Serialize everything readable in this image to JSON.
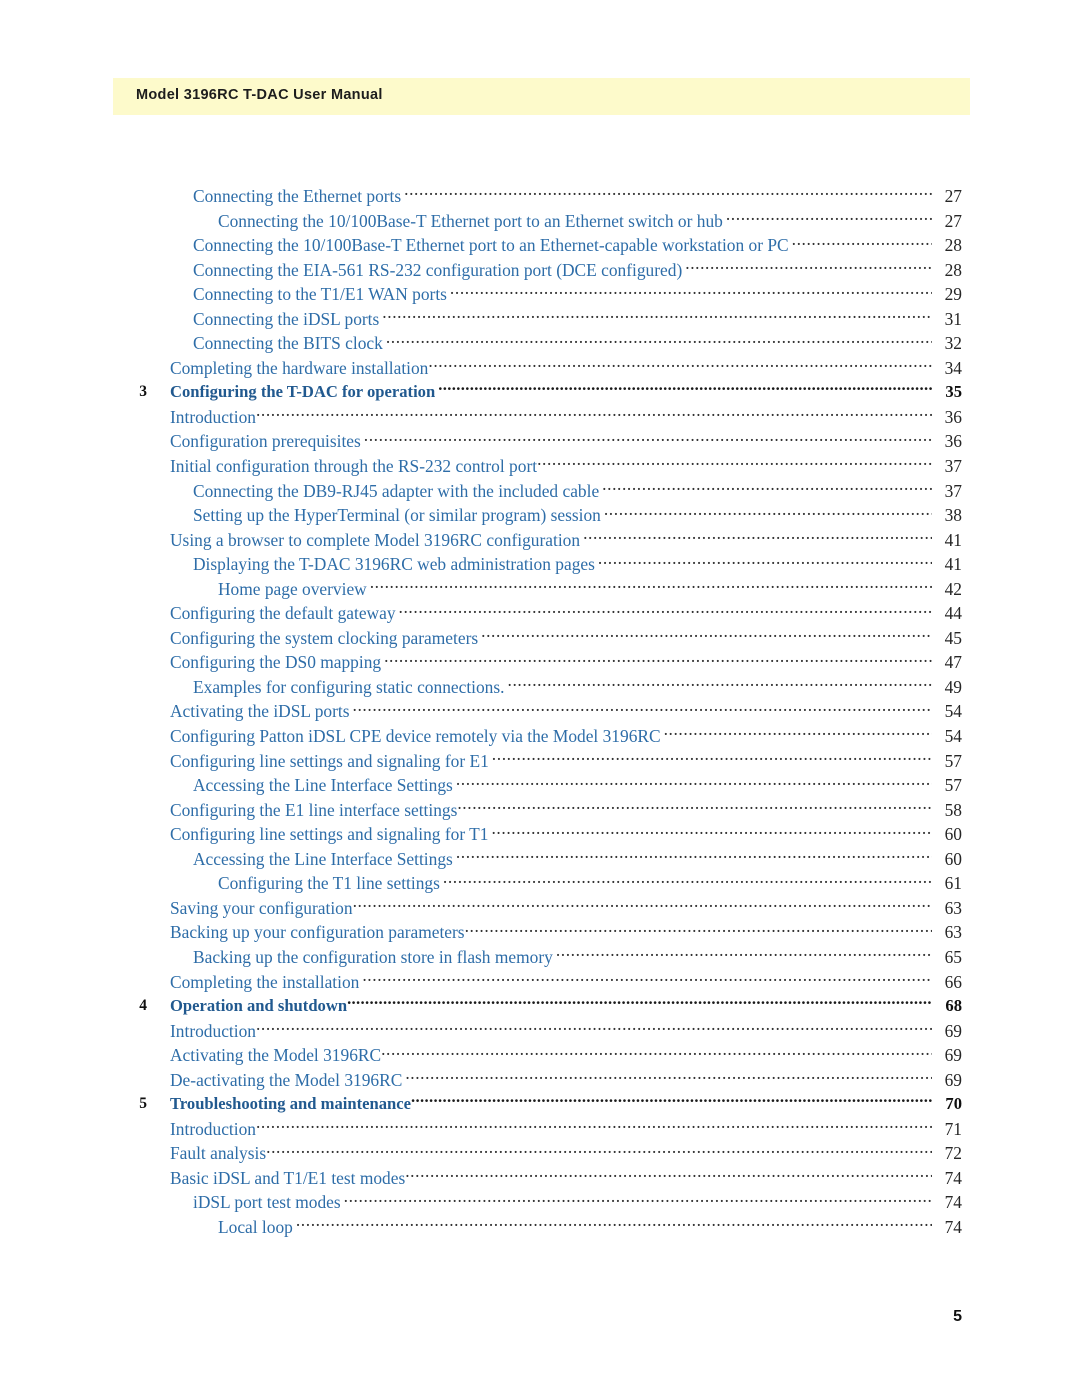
{
  "header": {
    "title": "Model 3196RC T-DAC User Manual"
  },
  "folio": {
    "page_number": "5"
  },
  "toc": {
    "entries": [
      {
        "level": 2,
        "number": "",
        "label": "Connecting the Ethernet ports",
        "page": "27",
        "nogap": false
      },
      {
        "level": 3,
        "number": "",
        "label": "Connecting the 10/100Base-T Ethernet port to an Ethernet switch or hub",
        "page": "27",
        "nogap": false
      },
      {
        "level": 2,
        "number": "",
        "label": "Connecting the 10/100Base-T Ethernet port to an Ethernet-capable workstation or PC",
        "page": "28",
        "nogap": false
      },
      {
        "level": 2,
        "number": "",
        "label": "Connecting the EIA-561 RS-232 configuration port (DCE configured)",
        "page": "28",
        "nogap": false
      },
      {
        "level": 2,
        "number": "",
        "label": "Connecting to the T1/E1 WAN ports",
        "page": "29",
        "nogap": false
      },
      {
        "level": 2,
        "number": "",
        "label": "Connecting the iDSL ports",
        "page": "31",
        "nogap": false
      },
      {
        "level": 2,
        "number": "",
        "label": "Connecting the BITS clock",
        "page": "32",
        "nogap": false
      },
      {
        "level": 1,
        "number": "",
        "label": "Completing the hardware installation",
        "page": "34",
        "nogap": true
      },
      {
        "level": 0,
        "number": "3",
        "label": "Configuring the T-DAC for operation",
        "page": "35",
        "nogap": false
      },
      {
        "level": 1,
        "number": "",
        "label": "Introduction",
        "page": "36",
        "nogap": true
      },
      {
        "level": 1,
        "number": "",
        "label": "Configuration prerequisites",
        "page": "36",
        "nogap": false
      },
      {
        "level": 1,
        "number": "",
        "label": "Initial configuration through the RS-232 control port",
        "page": "37",
        "nogap": true
      },
      {
        "level": 2,
        "number": "",
        "label": "Connecting the DB9-RJ45 adapter with the included cable",
        "page": "37",
        "nogap": false
      },
      {
        "level": 2,
        "number": "",
        "label": "Setting up the HyperTerminal (or similar program) session",
        "page": "38",
        "nogap": false
      },
      {
        "level": 1,
        "number": "",
        "label": "Using a browser to complete Model 3196RC configuration",
        "page": "41",
        "nogap": false
      },
      {
        "level": 2,
        "number": "",
        "label": "Displaying the T-DAC 3196RC web administration pages",
        "page": "41",
        "nogap": false
      },
      {
        "level": 3,
        "number": "",
        "label": "Home page overview",
        "page": "42",
        "nogap": false
      },
      {
        "level": 1,
        "number": "",
        "label": "Configuring the default gateway",
        "page": "44",
        "nogap": false
      },
      {
        "level": 1,
        "number": "",
        "label": "Configuring the system clocking parameters",
        "page": "45",
        "nogap": false
      },
      {
        "level": 1,
        "number": "",
        "label": "Configuring the DS0 mapping",
        "page": "47",
        "nogap": false
      },
      {
        "level": 2,
        "number": "",
        "label": "Examples for configuring static connections.",
        "page": "49",
        "nogap": false
      },
      {
        "level": 1,
        "number": "",
        "label": "Activating the iDSL ports",
        "page": "54",
        "nogap": false
      },
      {
        "level": 1,
        "number": "",
        "label": "Configuring Patton iDSL CPE device remotely via the Model 3196RC",
        "page": "54",
        "nogap": false
      },
      {
        "level": 1,
        "number": "",
        "label": "Configuring line settings and signaling for E1",
        "page": "57",
        "nogap": false
      },
      {
        "level": 2,
        "number": "",
        "label": "Accessing the Line Interface Settings",
        "page": "57",
        "nogap": false
      },
      {
        "level": 1,
        "number": "",
        "label": "Configuring the E1 line interface settings",
        "page": "58",
        "nogap": true
      },
      {
        "level": 1,
        "number": "",
        "label": "Configuring line settings and signaling for T1",
        "page": "60",
        "nogap": false
      },
      {
        "level": 2,
        "number": "",
        "label": "Accessing the Line Interface Settings",
        "page": "60",
        "nogap": false
      },
      {
        "level": 3,
        "number": "",
        "label": "Configuring the T1 line settings",
        "page": "61",
        "nogap": false
      },
      {
        "level": 1,
        "number": "",
        "label": "Saving your configuration",
        "page": "63",
        "nogap": true
      },
      {
        "level": 1,
        "number": "",
        "label": "Backing up your configuration parameters",
        "page": "63",
        "nogap": true
      },
      {
        "level": 2,
        "number": "",
        "label": "Backing up the configuration store in flash memory",
        "page": "65",
        "nogap": false
      },
      {
        "level": 1,
        "number": "",
        "label": "Completing the installation",
        "page": "66",
        "nogap": false
      },
      {
        "level": 0,
        "number": "4",
        "label": "Operation and shutdown",
        "page": "68",
        "nogap": true
      },
      {
        "level": 1,
        "number": "",
        "label": "Introduction",
        "page": "69",
        "nogap": true
      },
      {
        "level": 1,
        "number": "",
        "label": "Activating the Model 3196RC",
        "page": "69",
        "nogap": true
      },
      {
        "level": 1,
        "number": "",
        "label": "De-activating the Model 3196RC",
        "page": "69",
        "nogap": false
      },
      {
        "level": 0,
        "number": "5",
        "label": "Troubleshooting and maintenance",
        "page": "70",
        "nogap": true
      },
      {
        "level": 1,
        "number": "",
        "label": "Introduction",
        "page": "71",
        "nogap": true
      },
      {
        "level": 1,
        "number": "",
        "label": "Fault analysis",
        "page": "72",
        "nogap": true
      },
      {
        "level": 1,
        "number": "",
        "label": "Basic iDSL and T1/E1 test modes",
        "page": "74",
        "nogap": true
      },
      {
        "level": 2,
        "number": "",
        "label": "iDSL port test modes",
        "page": "74",
        "nogap": false
      },
      {
        "level": 3,
        "number": "",
        "label": "Local loop",
        "page": "74",
        "nogap": false
      }
    ]
  },
  "colors": {
    "header_band": "#FDFACB",
    "entry_blue": "#2E6DA8",
    "chapter_blue": "#21598F",
    "page_number": "#262626"
  }
}
